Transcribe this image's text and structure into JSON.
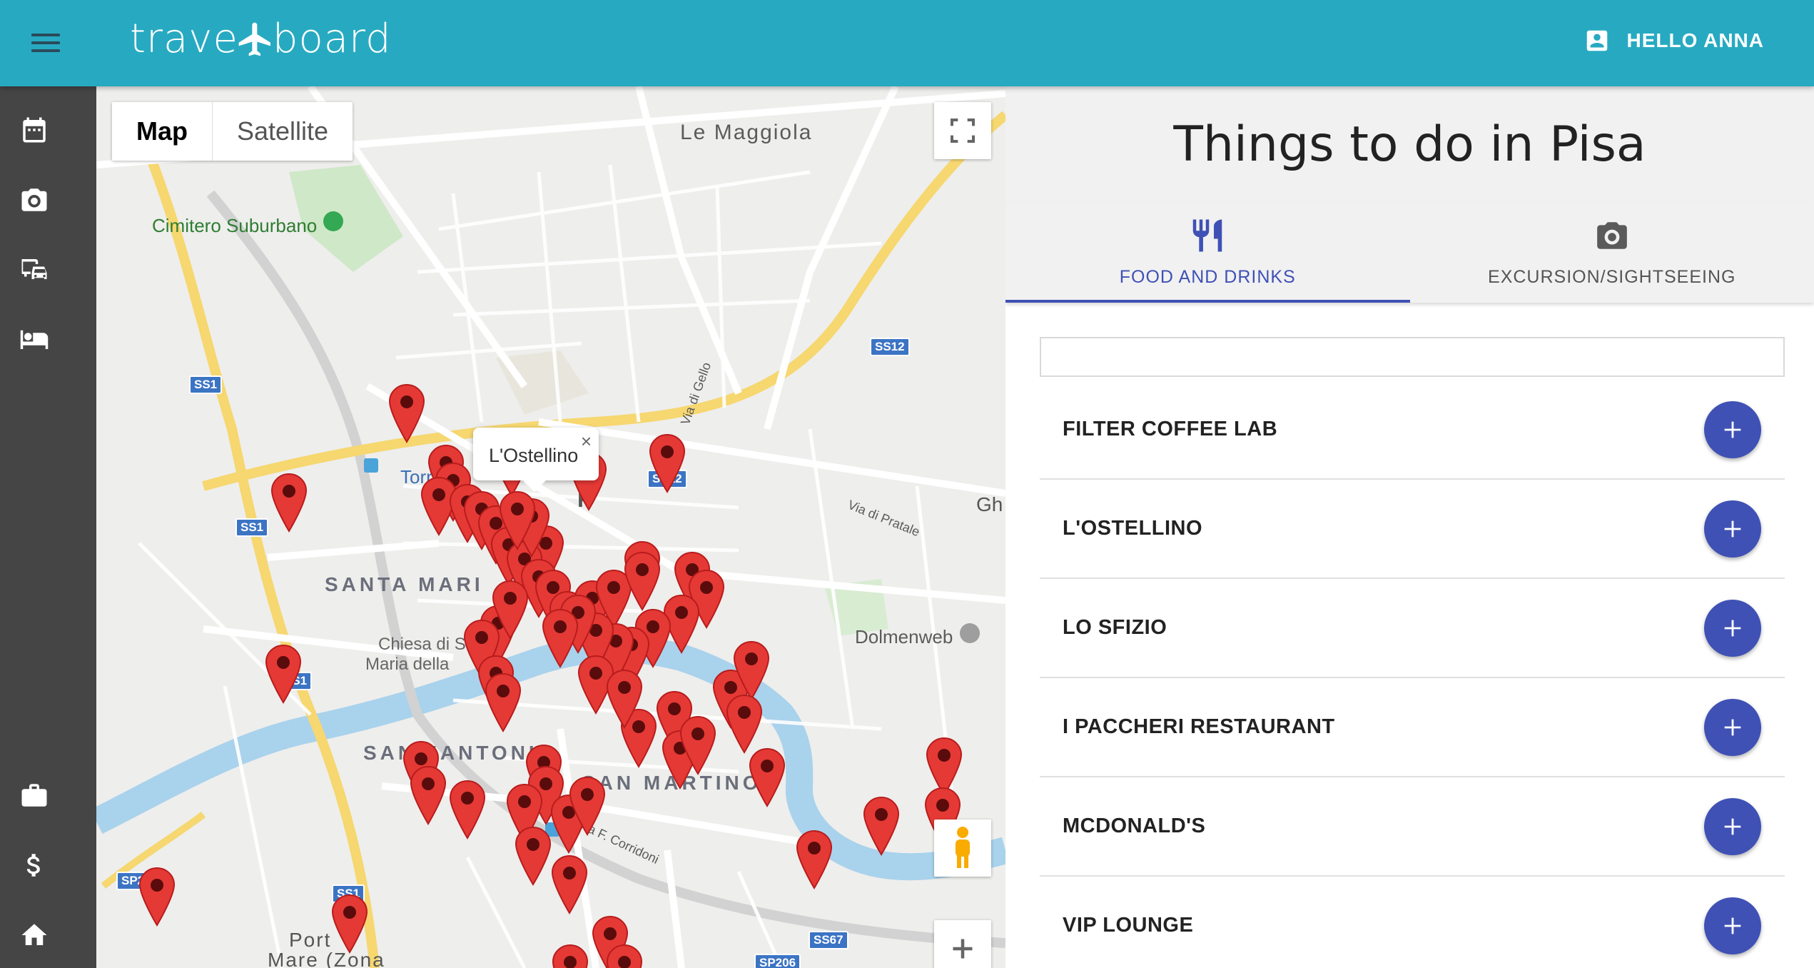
{
  "app": {
    "logo_left": "trave",
    "logo_right": "board",
    "user_greeting": "HELLO ANNA"
  },
  "sidebar": {
    "items": [
      {
        "icon": "calendar-icon"
      },
      {
        "icon": "camera-icon"
      },
      {
        "icon": "transport-icon"
      },
      {
        "icon": "bed-icon"
      },
      {
        "icon": "briefcase-icon"
      },
      {
        "icon": "dollar-icon"
      },
      {
        "icon": "home-icon"
      }
    ]
  },
  "map": {
    "type_map": "Map",
    "type_satellite": "Satellite",
    "popup_title": "L'Ostellino",
    "popup_close": "×",
    "labels": {
      "le_maggiola": "Le Maggiola",
      "cimitero": "Cimitero Suburbano",
      "santa_maria": "SANTA MARI",
      "chiesa_line1": "Chiesa di S",
      "chiesa_line2": "Maria della",
      "santantonio": "SANT'ANTONIO",
      "san_martino": "SAN MARTINO",
      "dolmenweb": "Dolmenweb",
      "via_gello": "Via di Gello",
      "via_pratale": "Via di Pratale",
      "via_corridoni": "Via F. Corridoni",
      "torre": "Torre",
      "porta_line1": "Port",
      "porta_line2": "Mare (Zona",
      "p_letter": "P",
      "gh": "Gh"
    },
    "shields": {
      "ss1_a": "SS1",
      "ss1_b": "SS1",
      "ss1_c": "SS1",
      "ss1_d": "SS1",
      "ss12_a": "SS12",
      "ss12_b": "SS12",
      "sp224": "SP224",
      "ss67": "SS67",
      "sp206": "SP206"
    },
    "pin_color": "#e53935"
  },
  "panel": {
    "title": "Things to do in Pisa",
    "tabs": [
      {
        "label": "FOOD AND DRINKS",
        "icon": "utensils-icon",
        "active": true
      },
      {
        "label": "EXCURSION/SIGHTSEEING",
        "icon": "camera-icon",
        "active": false
      }
    ],
    "search_value": "",
    "places": [
      {
        "name": "FILTER COFFEE LAB"
      },
      {
        "name": "L'OSTELLINO"
      },
      {
        "name": "LO SFIZIO"
      },
      {
        "name": "I PACCHERI RESTAURANT"
      },
      {
        "name": "MCDONALD'S"
      },
      {
        "name": "VIP LOUNGE"
      }
    ],
    "accent_color": "#3f51b5"
  },
  "colors": {
    "topbar": "#27aac1",
    "sidebar": "#454545"
  }
}
